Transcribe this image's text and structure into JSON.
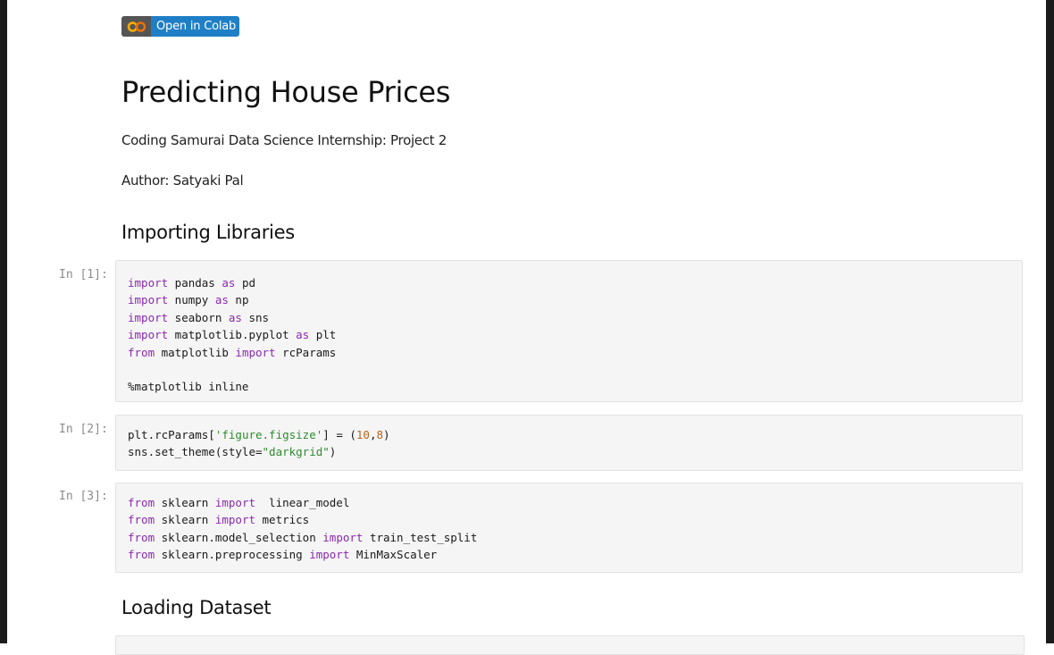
{
  "badge": {
    "label": "Open in Colab",
    "logo_text": "CO",
    "logo_color": "#f9ab00",
    "color": "#1f7fc6"
  },
  "title": "Predicting House Prices",
  "subtitle": "Coding Samurai Data Science Internship: Project 2",
  "author": "Author: Satyaki Pal",
  "sections": {
    "importing": "Importing Libraries",
    "loading": "Loading Dataset"
  },
  "cells": [
    {
      "prompt": "In [1]:",
      "lines": [
        [
          {
            "t": "import",
            "k": "kw"
          },
          {
            "t": " pandas "
          },
          {
            "t": "as",
            "k": "kw"
          },
          {
            "t": " pd"
          }
        ],
        [
          {
            "t": "import",
            "k": "kw"
          },
          {
            "t": " numpy "
          },
          {
            "t": "as",
            "k": "kw"
          },
          {
            "t": " np"
          }
        ],
        [
          {
            "t": "import",
            "k": "kw"
          },
          {
            "t": " seaborn "
          },
          {
            "t": "as",
            "k": "kw"
          },
          {
            "t": " sns"
          }
        ],
        [
          {
            "t": "import",
            "k": "kw"
          },
          {
            "t": " matplotlib.pyplot "
          },
          {
            "t": "as",
            "k": "kw"
          },
          {
            "t": " plt"
          }
        ],
        [
          {
            "t": "from",
            "k": "kw"
          },
          {
            "t": " matplotlib "
          },
          {
            "t": "import",
            "k": "kw"
          },
          {
            "t": " rcParams"
          }
        ],
        [],
        [
          {
            "t": "%matplotlib inline"
          }
        ]
      ]
    },
    {
      "prompt": "In [2]:",
      "lines": [
        [
          {
            "t": "plt.rcParams["
          },
          {
            "t": "'figure.figsize'",
            "k": "str"
          },
          {
            "t": "] = ("
          },
          {
            "t": "10",
            "k": "num"
          },
          {
            "t": ","
          },
          {
            "t": "8",
            "k": "num"
          },
          {
            "t": ")"
          }
        ],
        [
          {
            "t": "sns.set_theme(style="
          },
          {
            "t": "\"darkgrid\"",
            "k": "str"
          },
          {
            "t": ")"
          }
        ]
      ]
    },
    {
      "prompt": "In [3]:",
      "lines": [
        [
          {
            "t": "from",
            "k": "kw"
          },
          {
            "t": " sklearn "
          },
          {
            "t": "import",
            "k": "kw"
          },
          {
            "t": "  linear_model"
          }
        ],
        [
          {
            "t": "from",
            "k": "kw"
          },
          {
            "t": " sklearn "
          },
          {
            "t": "import",
            "k": "kw"
          },
          {
            "t": " metrics"
          }
        ],
        [
          {
            "t": "from",
            "k": "kw"
          },
          {
            "t": " sklearn.model_selection "
          },
          {
            "t": "import",
            "k": "kw"
          },
          {
            "t": " train_test_split"
          }
        ],
        [
          {
            "t": "from",
            "k": "kw"
          },
          {
            "t": " sklearn.preprocessing "
          },
          {
            "t": "import",
            "k": "kw"
          },
          {
            "t": " MinMaxScaler"
          }
        ]
      ]
    }
  ]
}
